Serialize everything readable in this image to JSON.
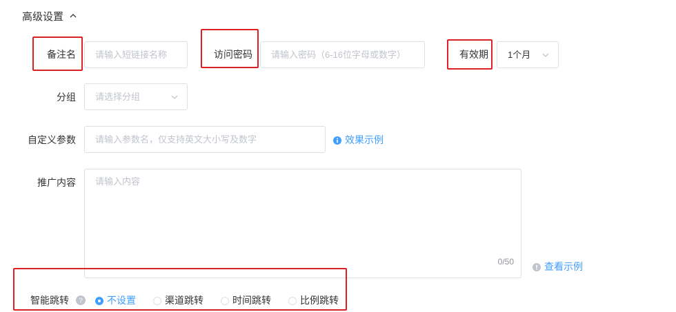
{
  "section": {
    "title": "高级设置",
    "toggle_icon": "chevron-up-icon"
  },
  "fields": {
    "remark": {
      "label": "备注名",
      "placeholder": "请输入短链接名称"
    },
    "password": {
      "label": "访问密码",
      "placeholder": "请输入密码（6-16位字母或数字）"
    },
    "validity": {
      "label": "有效期",
      "value": "1个月"
    },
    "group": {
      "label": "分组",
      "placeholder": "请选择分组"
    },
    "custom_param": {
      "label": "自定义参数",
      "placeholder": "请输入参数名，仅支持英文大小写及数字",
      "help_link": "效果示例"
    },
    "promo": {
      "label": "推广内容",
      "placeholder": "请输入内容",
      "counter": "0/50",
      "help_link": "查看示例"
    },
    "smart_jump": {
      "label": "智能跳转",
      "options": [
        {
          "label": "不设置",
          "selected": true
        },
        {
          "label": "渠道跳转",
          "selected": false
        },
        {
          "label": "时间跳转",
          "selected": false
        },
        {
          "label": "比例跳转",
          "selected": false
        }
      ]
    }
  },
  "colors": {
    "accent": "#409eff",
    "highlight": "#e02020",
    "border": "#dcdfe6",
    "placeholder": "#c0c4cc"
  }
}
